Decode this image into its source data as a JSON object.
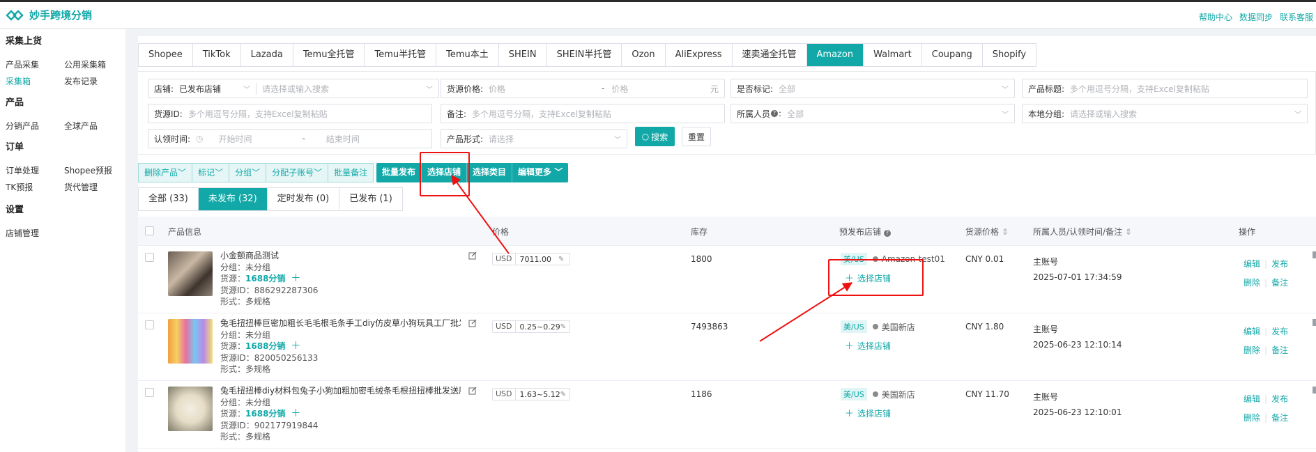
{
  "app": {
    "name": "妙手跨境分销",
    "accent": "#13a8a8"
  },
  "header": {
    "links": [
      "帮助中心",
      "数据同步",
      "联系客服"
    ]
  },
  "sidebar": [
    {
      "group": "采集上货",
      "rows": [
        [
          "产品采集",
          "公用采集箱"
        ],
        [
          "采集箱",
          "发布记录"
        ]
      ]
    },
    {
      "group": "产品",
      "rows": [
        [
          "分销产品",
          "全球产品"
        ]
      ]
    },
    {
      "group": "订单",
      "rows": [
        [
          "订单处理",
          "Shopee预报"
        ],
        [
          "TK预报",
          "货代管理"
        ]
      ]
    },
    {
      "group": "设置",
      "rows": [
        [
          "店铺管理"
        ]
      ]
    }
  ],
  "sidebar_active": "采集箱",
  "platform_tabs": [
    "Shopee",
    "TikTok",
    "Lazada",
    "Temu全托管",
    "Temu半托管",
    "Temu本土",
    "SHEIN",
    "SHEIN半托管",
    "Ozon",
    "AliExpress",
    "速卖通全托管",
    "Amazon",
    "Walmart",
    "Coupang",
    "Shopify"
  ],
  "platform_active": "Amazon",
  "filters": {
    "store_label": "店铺:",
    "store_value": "已发布店铺",
    "store_placeholder": "请选择或输入搜索",
    "price_label": "货源价格:",
    "price_min_ph": "价格",
    "price_sep": "-",
    "price_max_ph": "价格",
    "price_unit": "元",
    "mark_label": "是否标记:",
    "mark_value": "全部",
    "title_label": "产品标题:",
    "title_ph": "多个用逗号分隔，支持Excel复制粘贴",
    "source_id_label": "货源ID:",
    "source_id_ph": "多个用逗号分隔，支持Excel复制粘贴",
    "remark_label": "备注:",
    "remark_ph": "多个用逗号分隔，支持Excel复制粘贴",
    "owner_label": "所属人员",
    "owner_value": "全部",
    "group_label": "本地分组:",
    "group_ph": "请选择或输入搜索",
    "claim_label": "认领时间:",
    "claim_start_ph": "开始时间",
    "claim_sep": "-",
    "claim_end_ph": "结束时间",
    "form_label": "产品形式:",
    "form_ph": "请选择",
    "search_btn": "搜索",
    "reset_btn": "重置"
  },
  "action_buttons_light": [
    "删除产品",
    "标记",
    "分组",
    "分配子账号",
    "批量备注"
  ],
  "action_buttons_solid": [
    "批量发布",
    "选择店铺",
    "选择类目",
    "编辑更多"
  ],
  "status_tabs": [
    "全部 (33)",
    "未发布 (32)",
    "定时发布 (0)",
    "已发布 (1)"
  ],
  "status_active": "未发布 (32)",
  "table": {
    "headers": {
      "product": "产品信息",
      "price": "价格",
      "stock": "库存",
      "store": "预发布店铺",
      "src_price": "货源价格",
      "owner": "所属人员/认领时间/备注",
      "ops": "操作"
    },
    "rows": [
      {
        "title": "小金额商品测试",
        "group": "分组：未分组",
        "source_label": "货源：",
        "source": "1688分销",
        "source_id": "货源ID：886292287306",
        "form": "形式：多规格",
        "currency": "USD",
        "price": "7011.00",
        "stock": "1800",
        "region": "美/US",
        "store": "Amazon-test01",
        "choose_store": "选择店铺",
        "src_price": "CNY 0.01",
        "owner": "主账号",
        "time": "2025-07-01 17:34:59",
        "ops": [
          "编辑",
          "发布",
          "删除",
          "备注"
        ]
      },
      {
        "title": "兔毛扭扭棒巨密加粗长毛毛根毛条手工diy仿皮草小狗玩具工厂批发",
        "group": "分组：未分组",
        "source_label": "货源：",
        "source": "1688分销",
        "source_id": "货源ID：820050256133",
        "form": "形式：多规格",
        "currency": "USD",
        "price": "0.25~0.29",
        "stock": "7493863",
        "region": "美/US",
        "store": "美国新店",
        "choose_store": "选择店铺",
        "src_price": "CNY 1.80",
        "owner": "主账号",
        "time": "2025-06-23 12:10:14",
        "ops": [
          "编辑",
          "发布",
          "删除",
          "备注"
        ]
      },
      {
        "title": "兔毛扭扭棒diy材料包兔子小狗加粗加密毛绒条毛根扭扭棒批发送朋友",
        "group": "分组：未分组",
        "source_label": "货源：",
        "source": "1688分销",
        "source_id": "货源ID：902177919844",
        "form": "形式：多规格",
        "currency": "USD",
        "price": "1.63~5.12",
        "stock": "1186",
        "region": "美/US",
        "store": "美国新店",
        "choose_store": "选择店铺",
        "src_price": "CNY 11.70",
        "owner": "主账号",
        "time": "2025-06-23 12:10:01",
        "ops": [
          "编辑",
          "发布",
          "删除",
          "备注"
        ]
      }
    ]
  }
}
